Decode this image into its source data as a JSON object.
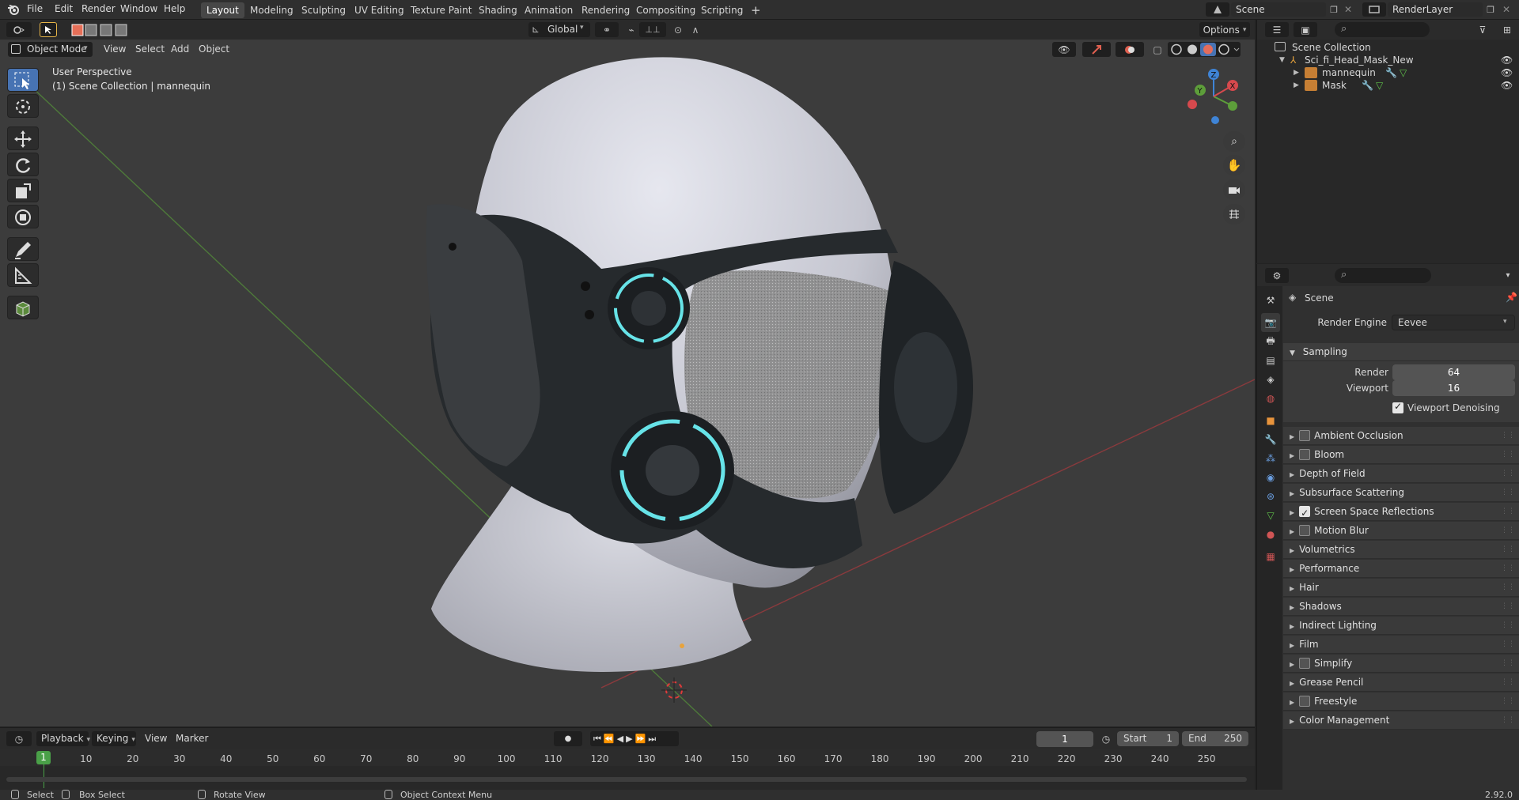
{
  "topbar": {
    "menus": [
      "File",
      "Edit",
      "Render",
      "Window",
      "Help"
    ],
    "workspaces": [
      "Layout",
      "Modeling",
      "Sculpting",
      "UV Editing",
      "Texture Paint",
      "Shading",
      "Animation",
      "Rendering",
      "Compositing",
      "Scripting"
    ],
    "active_workspace": "Layout",
    "add_tab": "+",
    "scene_name": "Scene",
    "view_layer": "RenderLayer"
  },
  "viewport_header": {
    "mode": "Object Mode",
    "menus": [
      "View",
      "Select",
      "Add",
      "Object"
    ],
    "orientation": "Global",
    "options": "Options"
  },
  "viewport": {
    "perspective": "User Perspective",
    "collection_info": "(1) Scene Collection | mannequin",
    "gizmo_axes": [
      "X",
      "Y",
      "Z"
    ],
    "colors": {
      "x_axis": "#d6494d",
      "y_axis": "#5d9e3a",
      "z_axis": "#3f84d6",
      "glow": "#67e3e8",
      "skin": "#cfd0d8",
      "mask": "#2a2d30",
      "bg": "#3c3c3c"
    }
  },
  "outliner": {
    "root": "Scene Collection",
    "collection": "Sci_fi_Head_Mask_New",
    "objects": [
      "mannequin",
      "Mask"
    ]
  },
  "properties": {
    "scene_label": "Scene",
    "render_engine_label": "Render Engine",
    "render_engine_value": "Eevee",
    "sampling": {
      "title": "Sampling",
      "render_label": "Render",
      "render_value": "64",
      "viewport_label": "Viewport",
      "viewport_value": "16",
      "denoise_label": "Viewport Denoising",
      "denoise_on": true
    },
    "panels": [
      {
        "label": "Ambient Occlusion",
        "checkbox": true,
        "checked": false
      },
      {
        "label": "Bloom",
        "checkbox": true,
        "checked": false
      },
      {
        "label": "Depth of Field",
        "checkbox": false,
        "checked": false
      },
      {
        "label": "Subsurface Scattering",
        "checkbox": false,
        "checked": false
      },
      {
        "label": "Screen Space Reflections",
        "checkbox": true,
        "checked": true
      },
      {
        "label": "Motion Blur",
        "checkbox": true,
        "checked": false
      },
      {
        "label": "Volumetrics",
        "checkbox": false,
        "checked": false
      },
      {
        "label": "Performance",
        "checkbox": false,
        "checked": false
      },
      {
        "label": "Hair",
        "checkbox": false,
        "checked": false
      },
      {
        "label": "Shadows",
        "checkbox": false,
        "checked": false
      },
      {
        "label": "Indirect Lighting",
        "checkbox": false,
        "checked": false
      },
      {
        "label": "Film",
        "checkbox": false,
        "checked": false
      },
      {
        "label": "Simplify",
        "checkbox": true,
        "checked": false
      },
      {
        "label": "Grease Pencil",
        "checkbox": false,
        "checked": false
      },
      {
        "label": "Freestyle",
        "checkbox": true,
        "checked": false
      },
      {
        "label": "Color Management",
        "checkbox": false,
        "checked": false
      }
    ]
  },
  "timeline": {
    "menus": [
      "Playback",
      "Keying",
      "View",
      "Marker"
    ],
    "current_frame": "1",
    "start_label": "Start",
    "start_value": "1",
    "end_label": "End",
    "end_value": "250",
    "ticks": [
      "10",
      "20",
      "30",
      "40",
      "50",
      "60",
      "70",
      "80",
      "90",
      "100",
      "110",
      "120",
      "130",
      "140",
      "150",
      "160",
      "170",
      "180",
      "190",
      "200",
      "210",
      "220",
      "230",
      "240",
      "250"
    ],
    "playhead": "1"
  },
  "statusbar": {
    "select": "Select",
    "box_select": "Box Select",
    "rotate": "Rotate View",
    "context_menu": "Object Context Menu",
    "version": "2.92.0"
  }
}
